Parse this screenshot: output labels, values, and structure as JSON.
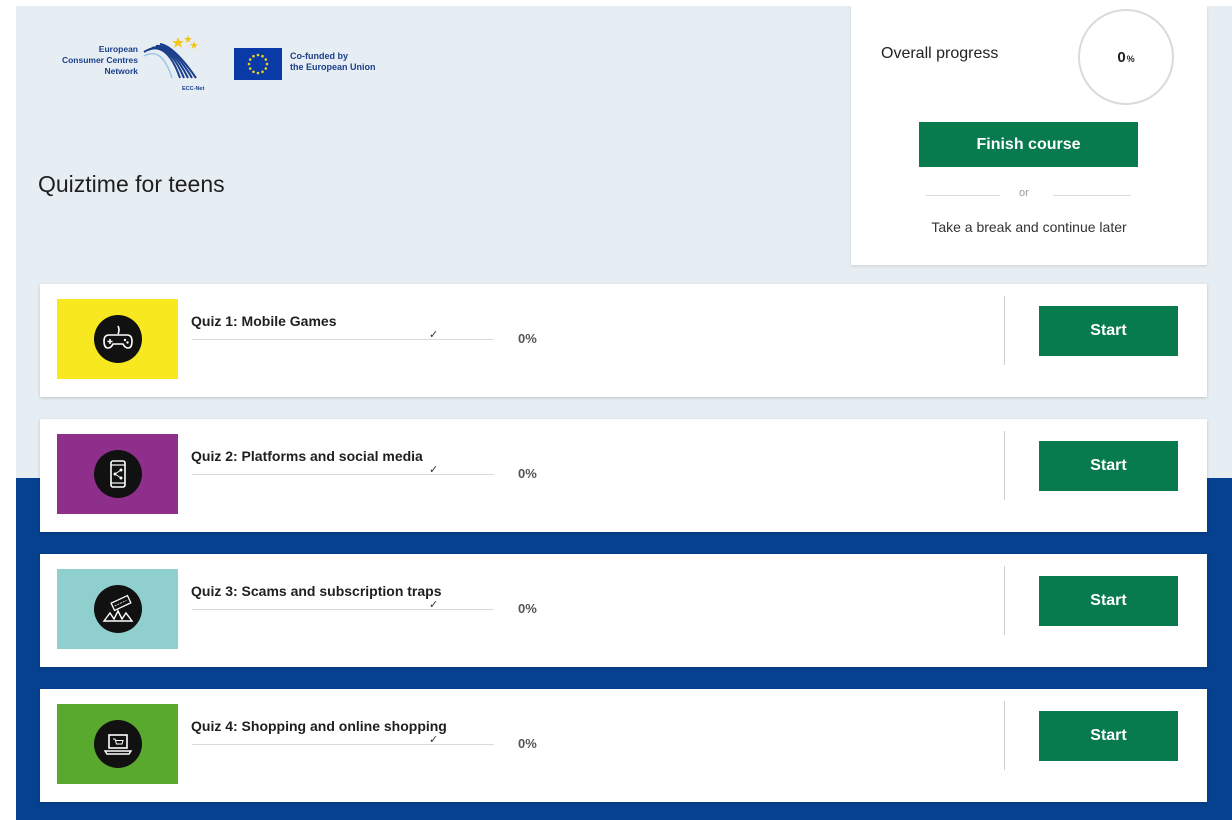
{
  "logos": {
    "ecc_lines": [
      "European",
      "Consumer Centres",
      "Network"
    ],
    "ecc_mark_label": "ECC-Net",
    "eu_lines": [
      "Co-funded by",
      "the European Union"
    ]
  },
  "course": {
    "title": "Quiztime for teens"
  },
  "progress_panel": {
    "label": "Overall progress",
    "value": "0",
    "unit": "%",
    "finish_label": "Finish course",
    "or_label": "or",
    "break_label": "Take a break and continue later"
  },
  "quizzes": [
    {
      "title": "Quiz 1: Mobile Games",
      "progress": 0,
      "progress_label": "0%",
      "start_label": "Start",
      "thumb_color": "#f7e81f",
      "icon": "gamepad-icon"
    },
    {
      "title": "Quiz 2: Platforms and social media",
      "progress": 0,
      "progress_label": "0%",
      "start_label": "Start",
      "thumb_color": "#8e2f8c",
      "icon": "phone-share-icon"
    },
    {
      "title": "Quiz 3: Scams and subscription traps",
      "progress": 0,
      "progress_label": "0%",
      "start_label": "Start",
      "thumb_color": "#8fd0cf",
      "icon": "subscription-trap-icon"
    },
    {
      "title": "Quiz 4: Shopping and online shopping",
      "progress": 0,
      "progress_label": "0%",
      "start_label": "Start",
      "thumb_color": "#5aa92f",
      "icon": "laptop-shop-icon"
    }
  ],
  "colors": {
    "header_background": "#e7eef3",
    "band_background": "#05418f",
    "button_green": "#077a4e"
  }
}
